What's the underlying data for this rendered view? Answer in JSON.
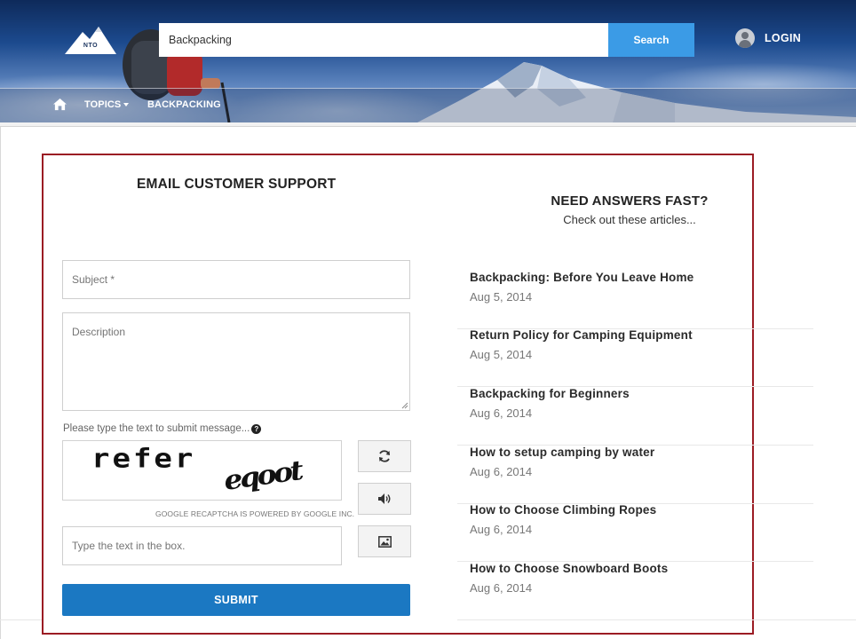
{
  "header": {
    "logo_text": "NTO",
    "search": {
      "value": "Backpacking",
      "button_label": "Search"
    },
    "login_label": "LOGIN",
    "nav": {
      "topics_label": "TOPICS",
      "current_topic_label": "BACKPACKING"
    }
  },
  "form": {
    "title": "EMAIL CUSTOMER SUPPORT",
    "subject_placeholder": "Subject *",
    "description_placeholder": "Description",
    "captcha_prompt": "Please type the text to submit message...",
    "captcha_words": [
      "refer",
      "eqoot"
    ],
    "recaptcha_note": "GOOGLE RECAPTCHA IS POWERED BY GOOGLE INC.",
    "captcha_response_placeholder": "Type the text in the box.",
    "submit_label": "SUBMIT"
  },
  "articles": {
    "title": "NEED ANSWERS FAST?",
    "subtitle": "Check out these articles...",
    "items": [
      {
        "title": "Backpacking: Before You Leave Home",
        "date": "Aug 5, 2014"
      },
      {
        "title": "Return Policy for Camping Equipment",
        "date": "Aug 5, 2014"
      },
      {
        "title": "Backpacking for Beginners",
        "date": "Aug 6, 2014"
      },
      {
        "title": "How to setup camping by water",
        "date": "Aug 6, 2014"
      },
      {
        "title": "How to Choose Climbing Ropes",
        "date": "Aug 6, 2014"
      },
      {
        "title": "How to Choose Snowboard Boots",
        "date": "Aug 6, 2014"
      }
    ]
  },
  "colors": {
    "search_button": "#3b9be6",
    "submit_button": "#1b78c2",
    "panel_border": "#9b1c24"
  },
  "icons": {
    "home": "home-icon",
    "user": "user-avatar-icon",
    "refresh": "refresh-icon",
    "audio": "speaker-icon",
    "image": "image-icon",
    "help": "question-circle-icon"
  }
}
